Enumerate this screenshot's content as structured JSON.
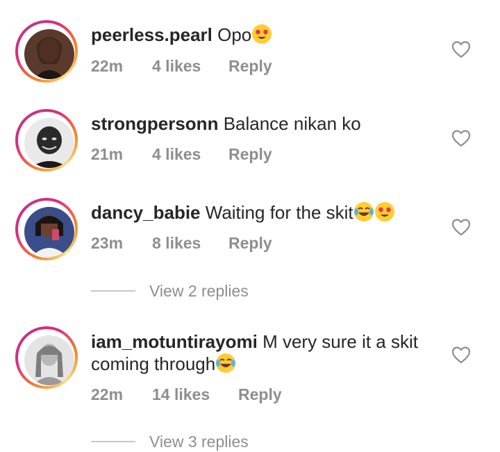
{
  "comments": [
    {
      "username": "peerless.pearl",
      "text": "Opo",
      "emojis": [
        "heart-eyes-emoji"
      ],
      "time": "22m",
      "likes": "4 likes",
      "reply": "Reply"
    },
    {
      "username": "strongpersonn",
      "text": "Balance nikan ko",
      "emojis": [],
      "time": "21m",
      "likes": "4 likes",
      "reply": "Reply"
    },
    {
      "username": "dancy_babie",
      "text": "Waiting for the skit",
      "emojis": [
        "tears-of-joy-emoji",
        "heart-eyes-emoji"
      ],
      "time": "23m",
      "likes": "8 likes",
      "reply": "Reply",
      "view_replies": "View 2 replies"
    },
    {
      "username": "iam_motuntirayomi",
      "text": "M very sure it a skit",
      "text_line2": "coming through",
      "emojis": [
        "tears-of-joy-emoji"
      ],
      "time": "22m",
      "likes": "14 likes",
      "reply": "Reply",
      "view_replies": "View 3 replies"
    }
  ],
  "icons": {
    "like": "heart-outline-icon"
  },
  "colors": {
    "text": "#262626",
    "secondary": "#8e8e8e",
    "ring_start": "#f58529",
    "ring_mid": "#dd2a7b",
    "ring_end": "#feda77"
  }
}
